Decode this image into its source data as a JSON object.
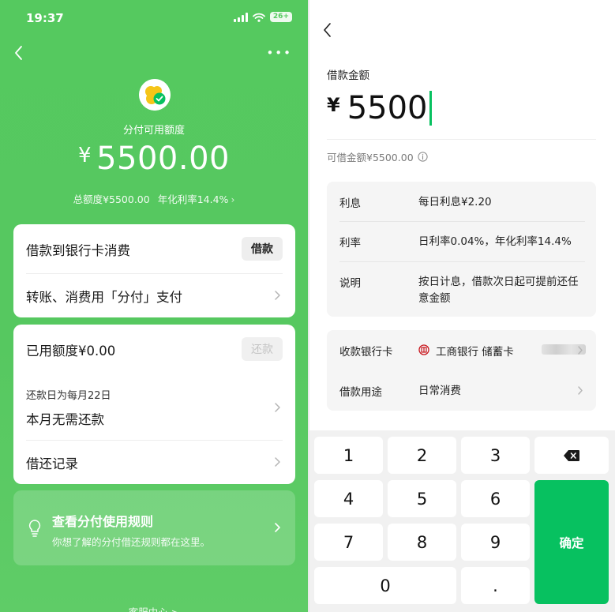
{
  "left": {
    "status": {
      "time": "19:37",
      "battery": "26+"
    },
    "header": {
      "credit_label": "分付可用额度",
      "credit_currency": "¥",
      "credit_amount": "5500.00",
      "total_limit": "总额度¥5500.00",
      "annual_rate": "年化利率14.4%"
    },
    "card1": {
      "borrow_row_label": "借款到银行卡消费",
      "borrow_button": "借款",
      "transfer_row_label": "转账、消费用「分付」支付"
    },
    "card2": {
      "used_label": "已用额度¥0.00",
      "repay_button": "还款",
      "repay_day": "还款日为每月22日",
      "repay_status": "本月无需还款",
      "records_label": "借还记录"
    },
    "rules": {
      "title": "查看分付使用规则",
      "subtitle": "你想了解的分付借还规则都在这里。"
    },
    "service_link": "客服中心 >"
  },
  "right": {
    "loan_label": "借款金额",
    "currency": "¥",
    "amount": "5500",
    "available": "可借金额¥5500.00",
    "details": [
      {
        "label": "利息",
        "value": "每日利息¥2.20"
      },
      {
        "label": "利率",
        "value": "日利率0.04%，年化利率14.4%"
      },
      {
        "label": "说明",
        "value": "按日计息，借款次日起可提前还任意金额"
      }
    ],
    "bank": {
      "label": "收款银行卡",
      "value": "工商银行 储蓄卡"
    },
    "purpose": {
      "label": "借款用途",
      "value": "日常消费"
    },
    "keypad": {
      "keys": [
        "1",
        "2",
        "3",
        "4",
        "5",
        "6",
        "7",
        "8",
        "9",
        "0",
        "."
      ],
      "confirm": "确定"
    }
  },
  "colors": {
    "brand_green": "#07c160",
    "panel_green": "#56c860",
    "bank_red": "#c8161d"
  },
  "icons": [
    "back-icon",
    "more-icon",
    "chevron-right-icon",
    "bulb-icon",
    "info-icon",
    "bank-logo-icon",
    "backspace-icon",
    "fenfu-logo-icon"
  ]
}
